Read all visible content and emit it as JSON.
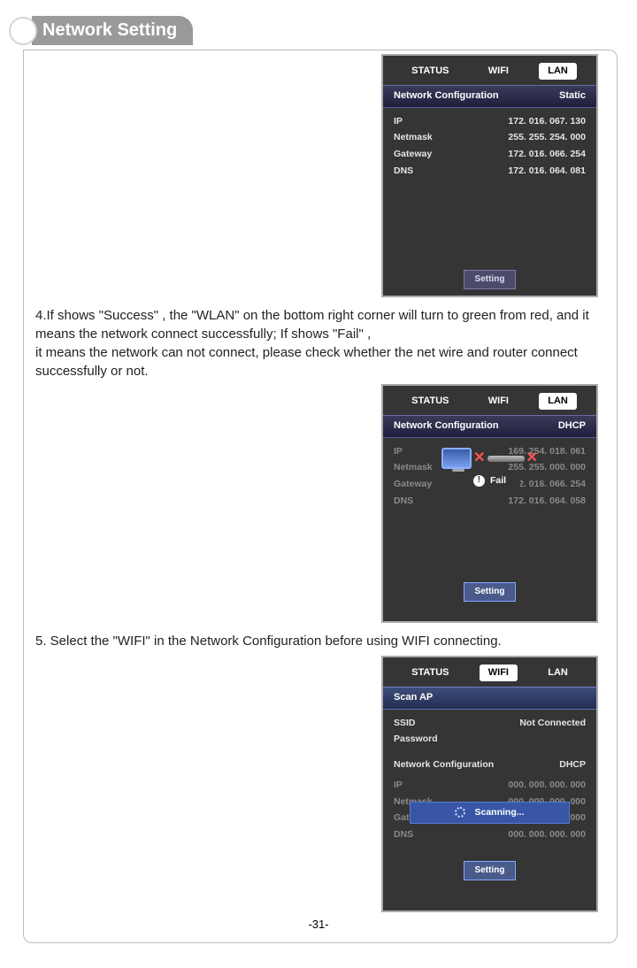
{
  "page": {
    "title": "Network Setting",
    "footer": "-31-"
  },
  "text4": "4.If shows \"Success\" , the  \"WLAN\" on the bottom right corner will turn to green from red, and it means the network connect successfully; If shows \"Fail\" ,",
  "text4b": "it means the network can not connect, please check whether the net wire and router  connect successfully or not.",
  "text5": "5. Select the \"WIFI\" in the Network Configuration before using WIFI connecting.",
  "screen1": {
    "tabs": {
      "status": "STATUS",
      "wifi": "WIFI",
      "lan": "LAN"
    },
    "band_left": "Network Configuration",
    "band_right": "Static",
    "ip_l": "IP",
    "ip_v": "172. 016. 067. 130",
    "nm_l": "Netmask",
    "nm_v": "255. 255. 254. 000",
    "gw_l": "Gateway",
    "gw_v": "172. 016. 066. 254",
    "dns_l": "DNS",
    "dns_v": "172. 016. 064. 081",
    "setting": "Setting"
  },
  "screen2": {
    "tabs": {
      "status": "STATUS",
      "wifi": "WIFI",
      "lan": "LAN"
    },
    "band_left": "Network Configuration",
    "band_right": "DHCP",
    "ip_l": "IP",
    "ip_v": "169. 254. 018. 061",
    "nm_l": "Netmask",
    "nm_v": "255. 255. 000. 000",
    "gw_l": "Gateway",
    "gw_v": "172. 016. 066. 254",
    "dns_l": "DNS",
    "dns_v": "172. 016. 064. 058",
    "fail": "Fail",
    "setting": "Setting"
  },
  "screen3": {
    "tabs": {
      "status": "STATUS",
      "wifi": "WIFI",
      "lan": "LAN"
    },
    "scan_ap": "Scan AP",
    "ssid_l": "SSID",
    "ssid_v": "Not Connected",
    "pwd_l": "Password",
    "band_left": "Network Configuration",
    "band_right": "DHCP",
    "ip_l": "IP",
    "ip_v": "000. 000. 000. 000",
    "nm_l": "Netmask",
    "nm_v": "000. 000. 000. 000",
    "gw_l": "Gateway",
    "gw_v": "000. 000. 000. 000",
    "dns_l": "DNS",
    "dns_v": "000. 000. 000. 000",
    "scanning": "Scanning...",
    "setting": "Setting"
  }
}
